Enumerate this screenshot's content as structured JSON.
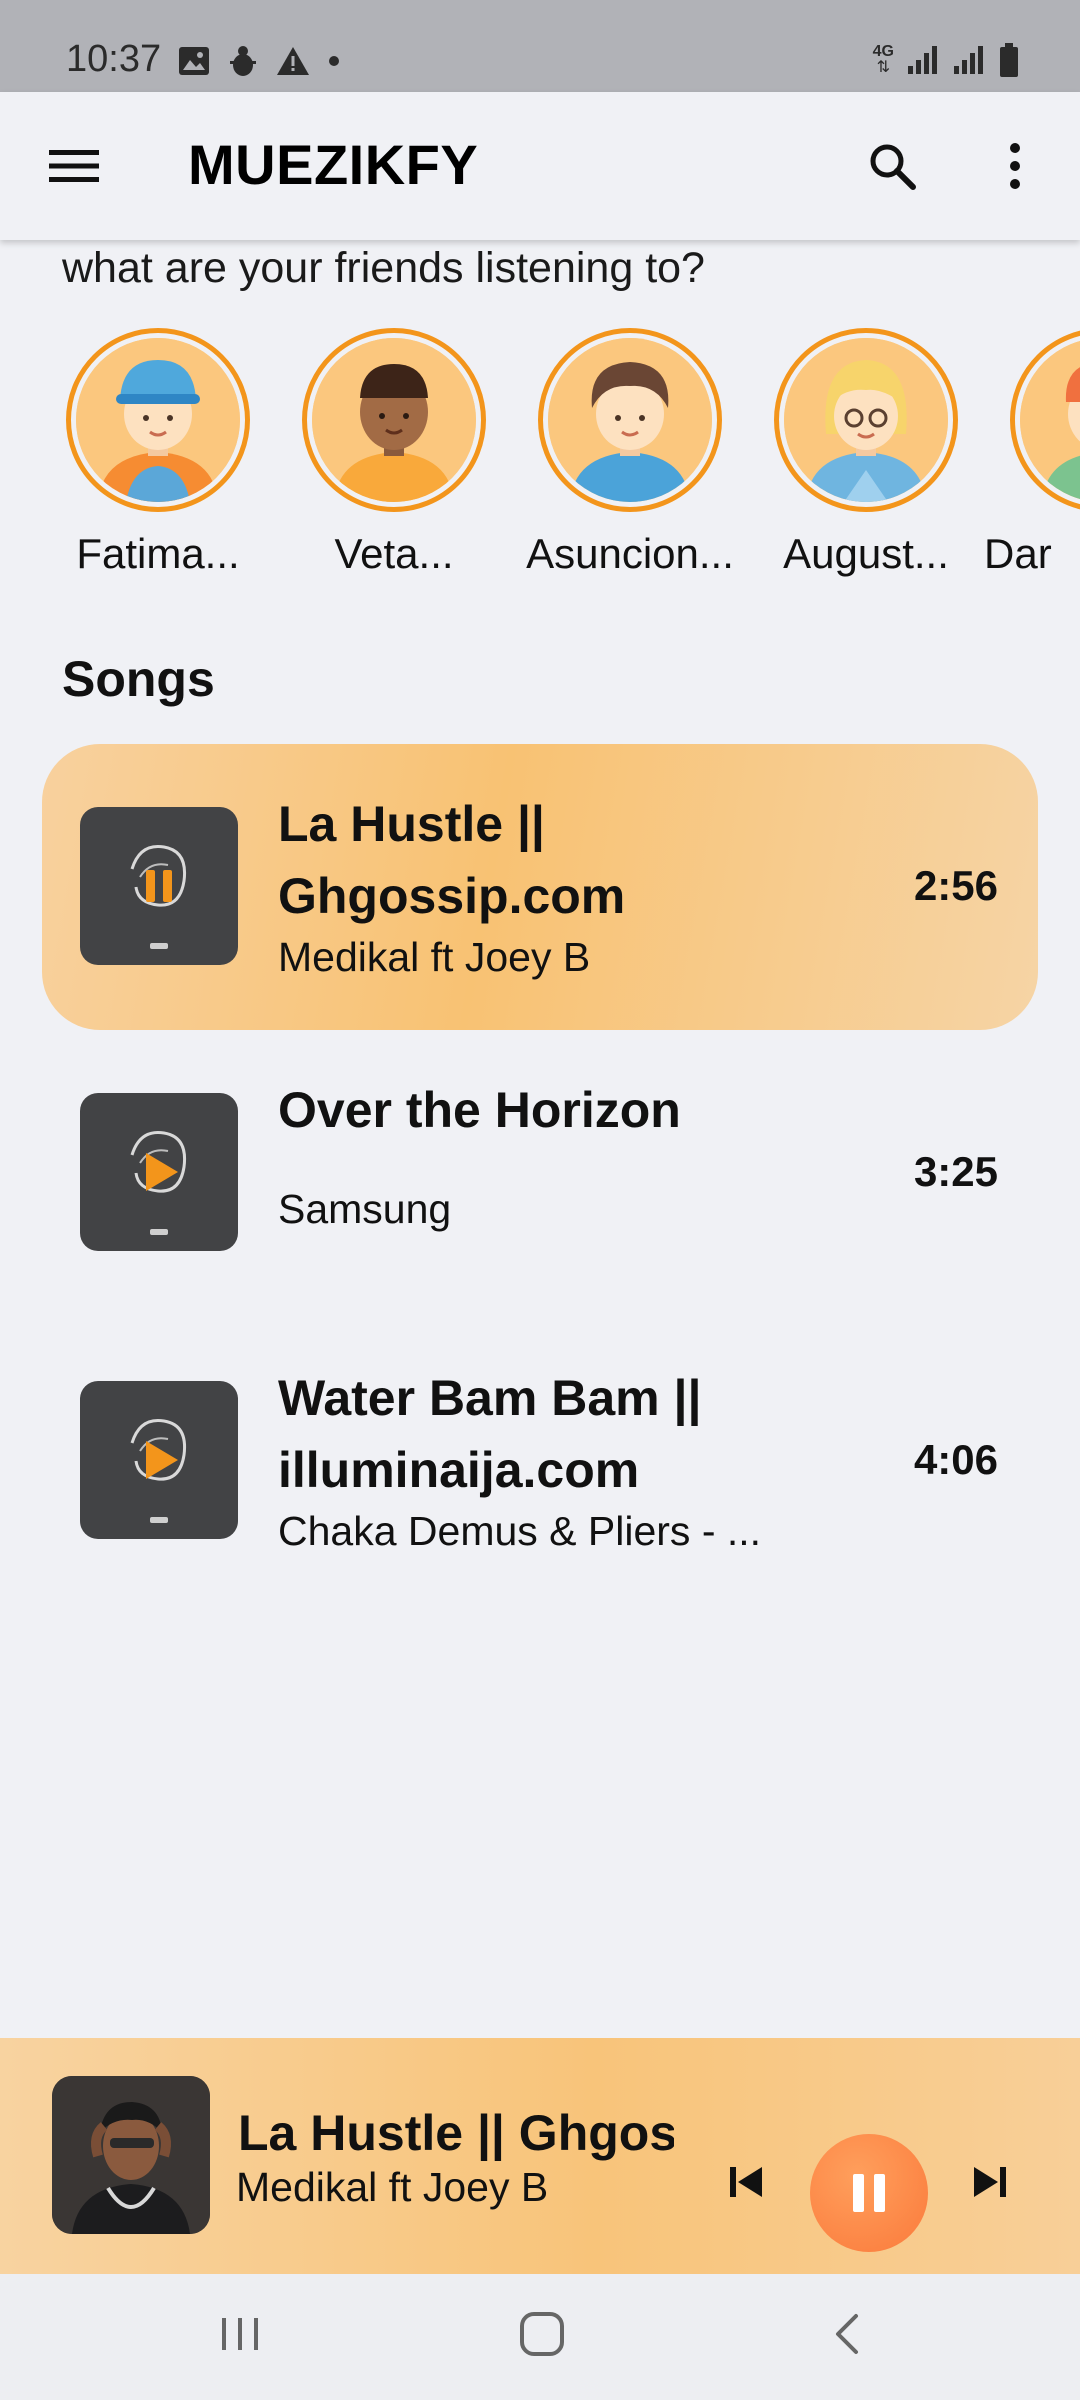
{
  "status_bar": {
    "time": "10:37",
    "icons_left": [
      "image-icon",
      "android-debug-icon",
      "warning-icon",
      "dot-icon"
    ],
    "network_label": "4G",
    "icons_right": [
      "signal-icon",
      "signal-icon",
      "battery-icon"
    ]
  },
  "app_bar": {
    "title": "MUEZIKFY",
    "icons": [
      "menu-icon",
      "search-icon",
      "more-vert-icon"
    ]
  },
  "friends": {
    "heading": "what are your friends listening to?",
    "items": [
      {
        "name": "Fatima..."
      },
      {
        "name": "Veta..."
      },
      {
        "name": "Asuncion..."
      },
      {
        "name": "August..."
      },
      {
        "name": "Dar"
      }
    ]
  },
  "songs": {
    "heading": "Songs",
    "items": [
      {
        "title": "La Hustle || Ghgossip.com",
        "artist": "Medikal ft Joey B",
        "duration": "2:56",
        "state": "playing"
      },
      {
        "title": "Over the Horizon",
        "artist": "Samsung",
        "duration": "3:25",
        "state": "paused"
      },
      {
        "title": "Water Bam Bam || illuminaija.com",
        "artist": "Chaka Demus & Pliers - ...",
        "duration": "4:06",
        "state": "paused"
      }
    ]
  },
  "now_playing": {
    "title": "La Hustle || Ghgossip.com",
    "artist": "Medikal ft Joey B",
    "controls": [
      "skip-previous-icon",
      "pause-icon",
      "skip-next-icon"
    ]
  },
  "colors": {
    "accent": "#f3951b",
    "active_row": "#f8c273",
    "play_button": "#fb7a3b",
    "background": "#f0f1f5",
    "thumb": "#424345"
  },
  "nav_bar": {
    "icons": [
      "recents-icon",
      "home-icon",
      "back-icon"
    ]
  }
}
